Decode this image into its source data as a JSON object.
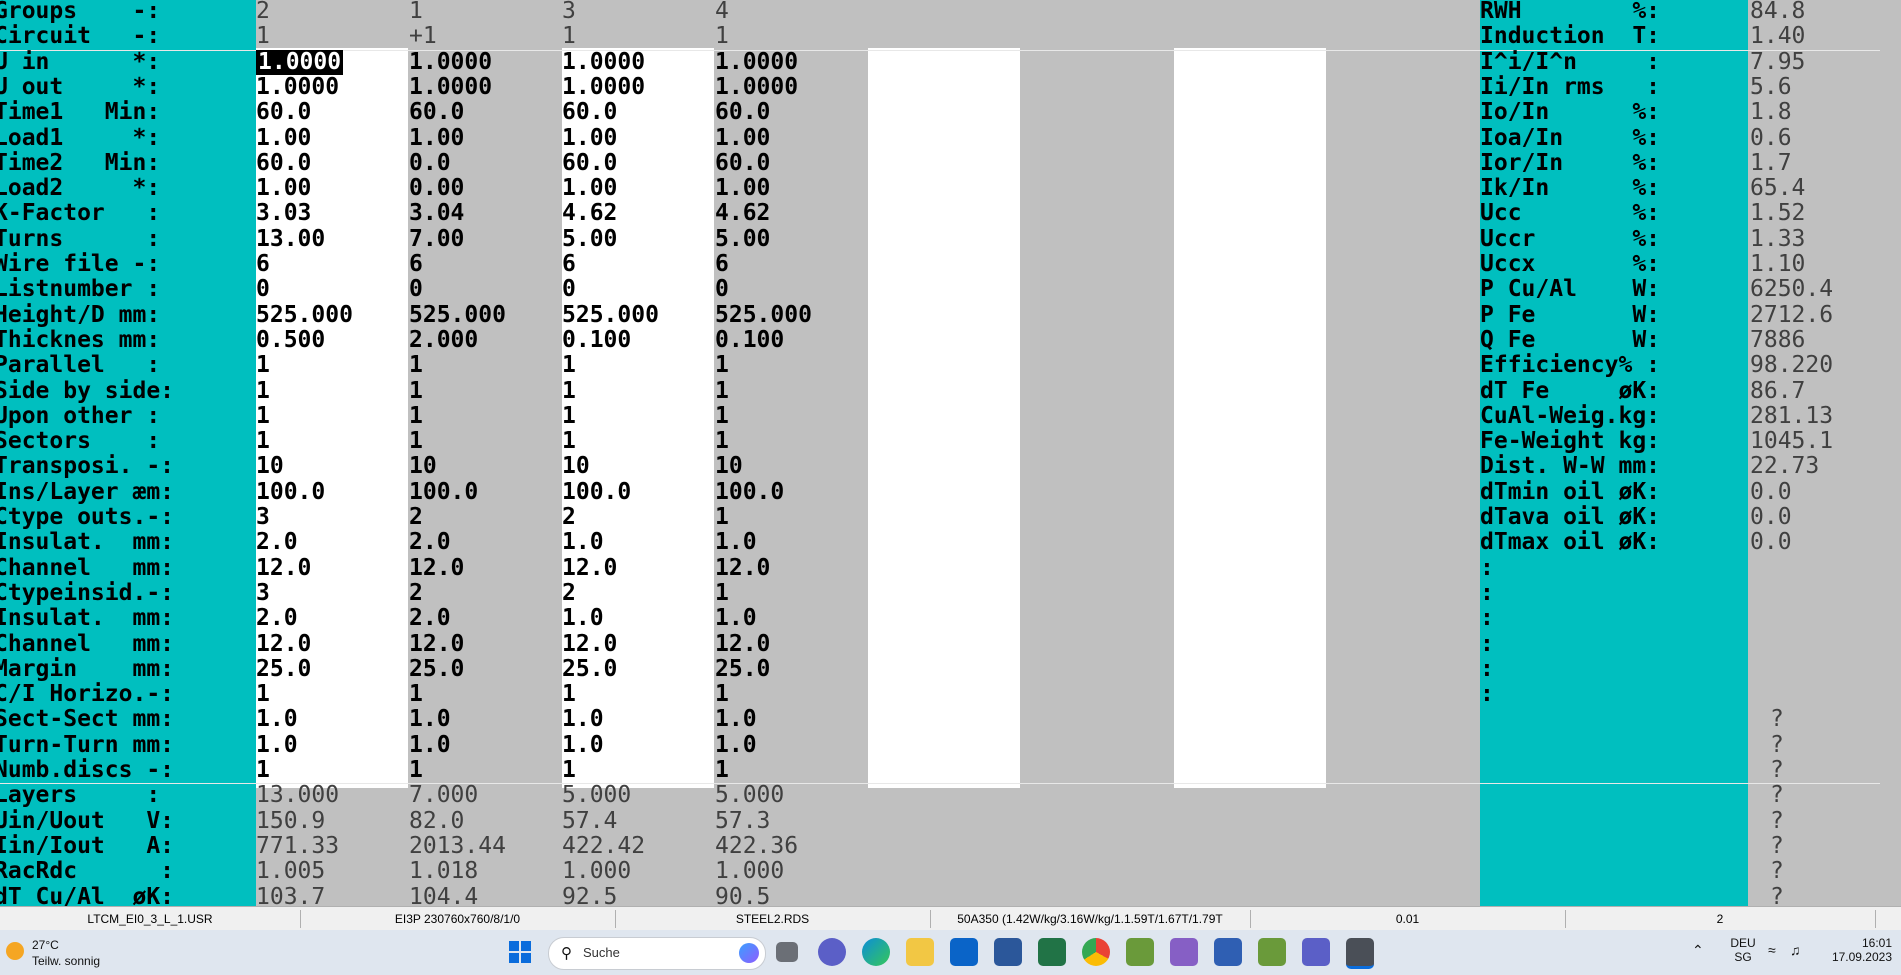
{
  "left_rows": [
    {
      "label": "Groups    -:",
      "vals": [
        "2",
        "1",
        "3",
        "4"
      ],
      "thin": true
    },
    {
      "label": "Circuit   -:",
      "vals": [
        "1",
        "+1",
        "1",
        "1"
      ],
      "thin": true
    },
    {
      "label": "U in      *:",
      "vals": [
        "1.0000",
        "1.0000",
        "1.0000",
        "1.0000"
      ]
    },
    {
      "label": "U out     *:",
      "vals": [
        "1.0000",
        "1.0000",
        "1.0000",
        "1.0000"
      ]
    },
    {
      "label": "Time1   Min:",
      "vals": [
        "60.0",
        "60.0",
        "60.0",
        "60.0"
      ]
    },
    {
      "label": "Load1     *:",
      "vals": [
        "1.00",
        "1.00",
        "1.00",
        "1.00"
      ]
    },
    {
      "label": "Time2   Min:",
      "vals": [
        "60.0",
        "0.0",
        "60.0",
        "60.0"
      ]
    },
    {
      "label": "Load2     *:",
      "vals": [
        "1.00",
        "0.00",
        "1.00",
        "1.00"
      ]
    },
    {
      "label": "K-Factor   :",
      "vals": [
        "3.03",
        "3.04",
        "4.62",
        "4.62"
      ]
    },
    {
      "label": "Turns      :",
      "vals": [
        "13.00",
        "7.00",
        "5.00",
        "5.00"
      ]
    },
    {
      "label": "Wire file -:",
      "vals": [
        "6",
        "6",
        "6",
        "6"
      ]
    },
    {
      "label": "Listnumber :",
      "vals": [
        "0",
        "0",
        "0",
        "0"
      ]
    },
    {
      "label": "Height/D mm:",
      "vals": [
        "525.000",
        "525.000",
        "525.000",
        "525.000"
      ]
    },
    {
      "label": "Thicknes mm:",
      "vals": [
        "0.500",
        "2.000",
        "0.100",
        "0.100"
      ]
    },
    {
      "label": "Parallel   :",
      "vals": [
        "1",
        "1",
        "1",
        "1"
      ]
    },
    {
      "label": "Side by side:",
      "vals": [
        "1",
        "1",
        "1",
        "1"
      ]
    },
    {
      "label": "Upon other :",
      "vals": [
        "1",
        "1",
        "1",
        "1"
      ]
    },
    {
      "label": "Sectors    :",
      "vals": [
        "1",
        "1",
        "1",
        "1"
      ]
    },
    {
      "label": "Transposi. -:",
      "vals": [
        "10",
        "10",
        "10",
        "10"
      ]
    },
    {
      "label": "Ins/Layer æm:",
      "vals": [
        "100.0",
        "100.0",
        "100.0",
        "100.0"
      ]
    },
    {
      "label": "Ctype outs.-:",
      "vals": [
        "3",
        "2",
        "2",
        "1"
      ]
    },
    {
      "label": "Insulat.  mm:",
      "vals": [
        "2.0",
        "2.0",
        "1.0",
        "1.0"
      ]
    },
    {
      "label": "Channel   mm:",
      "vals": [
        "12.0",
        "12.0",
        "12.0",
        "12.0"
      ]
    },
    {
      "label": "Ctypeinsid.-:",
      "vals": [
        "3",
        "2",
        "2",
        "1"
      ]
    },
    {
      "label": "Insulat.  mm:",
      "vals": [
        "2.0",
        "2.0",
        "1.0",
        "1.0"
      ]
    },
    {
      "label": "Channel   mm:",
      "vals": [
        "12.0",
        "12.0",
        "12.0",
        "12.0"
      ]
    },
    {
      "label": "Margin    mm:",
      "vals": [
        "25.0",
        "25.0",
        "25.0",
        "25.0"
      ]
    },
    {
      "label": "C/I Horizo.-:",
      "vals": [
        "1",
        "1",
        "1",
        "1"
      ]
    },
    {
      "label": "Sect-Sect mm:",
      "vals": [
        "1.0",
        "1.0",
        "1.0",
        "1.0"
      ]
    },
    {
      "label": "Turn-Turn mm:",
      "vals": [
        "1.0",
        "1.0",
        "1.0",
        "1.0"
      ]
    },
    {
      "label": "Numb.discs -:",
      "vals": [
        "1",
        "1",
        "1",
        "1"
      ]
    },
    {
      "label": "Layers     :",
      "vals": [
        "13.000",
        "7.000",
        "5.000",
        "5.000"
      ],
      "thin": true
    },
    {
      "label": "Uin/Uout   V:",
      "vals": [
        "150.9",
        "82.0",
        "57.4",
        "57.3"
      ],
      "thin": true
    },
    {
      "label": "Iin/Iout   A:",
      "vals": [
        "771.33",
        "2013.44",
        "422.42",
        "422.36"
      ],
      "thin": true
    },
    {
      "label": "RacRdc      :",
      "vals": [
        "1.005",
        "1.018",
        "1.000",
        "1.000"
      ],
      "thin": true
    },
    {
      "label": "dT Cu/Al  øK:",
      "vals": [
        "103.7",
        "104.4",
        "92.5",
        "90.5"
      ],
      "thin": true
    }
  ],
  "right_rows": [
    {
      "label": "RWH        %:",
      "val": "84.8"
    },
    {
      "label": "Induction  T:",
      "val": "1.40"
    },
    {
      "label": "I^i/I^n     :",
      "val": "7.95"
    },
    {
      "label": "Ii/In rms   :",
      "val": "5.6"
    },
    {
      "label": "Io/In      %:",
      "val": "1.8"
    },
    {
      "label": "Ioa/In     %:",
      "val": "0.6"
    },
    {
      "label": "Ior/In     %:",
      "val": "1.7"
    },
    {
      "label": "Ik/In      %:",
      "val": "65.4"
    },
    {
      "label": "Ucc        %:",
      "val": "1.52"
    },
    {
      "label": "Uccr       %:",
      "val": "1.33"
    },
    {
      "label": "Uccx       %:",
      "val": "1.10"
    },
    {
      "label": "P Cu/Al    W:",
      "val": "6250.4"
    },
    {
      "label": "P Fe       W:",
      "val": "2712.6"
    },
    {
      "label": "Q Fe       W:",
      "val": "7886"
    },
    {
      "label": "Efficiency% :",
      "val": "98.220"
    },
    {
      "label": "dT Fe     øK:",
      "val": "86.7"
    },
    {
      "label": "CuAl-Weig.kg:",
      "val": "281.13"
    },
    {
      "label": "Fe-Weight kg:",
      "val": "1045.1"
    },
    {
      "label": "Dist. W-W mm:",
      "val": "22.73"
    },
    {
      "label": "dTmin oil øK:",
      "val": "0.0"
    },
    {
      "label": "dTava oil øK:",
      "val": "0.0"
    },
    {
      "label": "dTmax oil øK:",
      "val": "0.0"
    },
    {
      "label": ":",
      "val": ""
    },
    {
      "label": ":",
      "val": ""
    },
    {
      "label": ":",
      "val": ""
    },
    {
      "label": ":",
      "val": ""
    },
    {
      "label": ":",
      "val": ""
    },
    {
      "label": ":",
      "val": ""
    },
    {
      "label": "",
      "val": "?"
    },
    {
      "label": "",
      "val": "?"
    },
    {
      "label": "",
      "val": "?"
    },
    {
      "label": "",
      "val": "?"
    },
    {
      "label": "",
      "val": "?"
    },
    {
      "label": "",
      "val": "?"
    },
    {
      "label": "",
      "val": "?"
    },
    {
      "label": "",
      "val": "?"
    }
  ],
  "status_bar": [
    "LTCM_EI0_3_L_1.USR",
    "EI3P 230760x760/8/1/0",
    "STEEL2.RDS",
    "50A350 (1.42W/kg/3.16W/kg/1.1.59T/1.67T/1.79T",
    "0.01",
    "2"
  ],
  "taskbar": {
    "weather_temp": "27°C",
    "weather_desc": "Teilw. sonnig",
    "search_placeholder": "Suche",
    "lang_top": "DEU",
    "lang_bottom": "SG",
    "time": "16:01",
    "date": "17.09.2023"
  },
  "colors": {
    "cyan": "#00bfbf",
    "grey": "#c0c0c0",
    "white": "#ffffff",
    "selection": "#000000"
  }
}
